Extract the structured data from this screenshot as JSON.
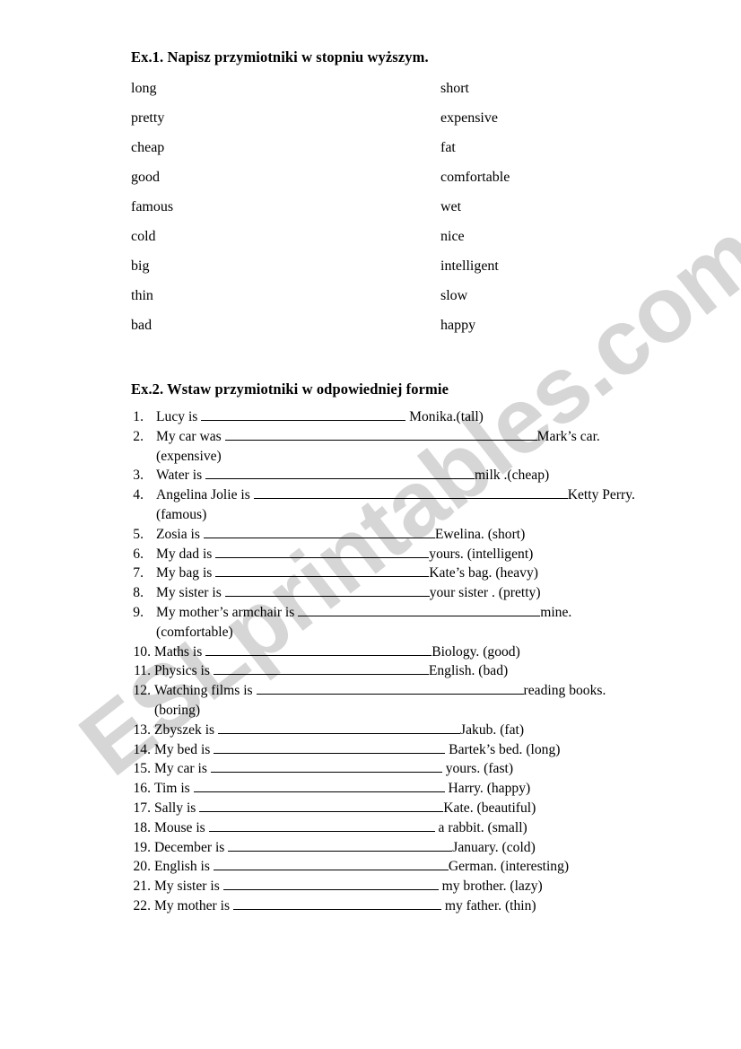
{
  "watermark": {
    "text": "ESLprintables.com",
    "color": "#d6d6d6"
  },
  "exercise1": {
    "heading": "Ex.1. Napisz przymiotniki w stopniu wyższym.",
    "pairs": [
      {
        "left": "long",
        "right": "short"
      },
      {
        "left": "pretty",
        "right": "expensive"
      },
      {
        "left": "cheap",
        "right": "fat"
      },
      {
        "left": "good",
        "right": "comfortable"
      },
      {
        "left": "famous",
        "right": "wet"
      },
      {
        "left": "cold",
        "right": "nice"
      },
      {
        "left": "big",
        "right": "intelligent"
      },
      {
        "left": "thin",
        "right": "slow"
      },
      {
        "left": "bad",
        "right": "happy"
      }
    ]
  },
  "exercise2": {
    "heading": "Ex.2. Wstaw przymiotniki w odpowiedniej formie",
    "items": [
      {
        "num": "1.",
        "pre": "Lucy is ",
        "blank": 228,
        "post": " Monika.(tall)",
        "cont": ""
      },
      {
        "num": "2.",
        "pre": "My car was ",
        "blank": 348,
        "post": "Mark’s car.",
        "cont": "(expensive)"
      },
      {
        "num": "3.",
        "pre": "Water is ",
        "blank": 300,
        "post": "milk .(cheap)",
        "cont": ""
      },
      {
        "num": "4.",
        "pre": "Angelina Jolie is ",
        "blank": 350,
        "post": "Ketty Perry.",
        "cont": "(famous)"
      },
      {
        "num": "5.",
        "pre": "Zosia is ",
        "blank": 258,
        "post": "Ewelina. (short)",
        "cont": ""
      },
      {
        "num": "6.",
        "pre": "My dad is ",
        "blank": 238,
        "post": "yours. (intelligent)",
        "cont": ""
      },
      {
        "num": "7.",
        "pre": "My bag is ",
        "blank": 238,
        "post": "Kate’s bag. (heavy)",
        "cont": ""
      },
      {
        "num": "8.",
        "pre": "My sister is ",
        "blank": 228,
        "post": "your sister . (pretty)",
        "cont": ""
      },
      {
        "num": "9.",
        "pre": "My mother’s armchair is ",
        "blank": 270,
        "post": "mine.",
        "cont": "(comfortable)"
      },
      {
        "num": "10.",
        "pre": "Maths is ",
        "blank": 252,
        "post": "Biology. (good)",
        "cont": ""
      },
      {
        "num": "11.",
        "pre": "Physics is ",
        "blank": 240,
        "post": "English. (bad)",
        "cont": ""
      },
      {
        "num": "12.",
        "pre": "Watching films is ",
        "blank": 298,
        "post": "reading books.",
        "cont": "(boring)"
      },
      {
        "num": "13.",
        "pre": "Zbyszek is ",
        "blank": 270,
        "post": "Jakub. (fat)",
        "cont": ""
      },
      {
        "num": "14.",
        "pre": "My bed is ",
        "blank": 258,
        "post": " Bartek’s bed. (long)",
        "cont": ""
      },
      {
        "num": "15.",
        "pre": "My car is ",
        "blank": 258,
        "post": " yours. (fast)",
        "cont": ""
      },
      {
        "num": "16.",
        "pre": "Tim is ",
        "blank": 280,
        "post": " Harry. (happy)",
        "cont": ""
      },
      {
        "num": "17.",
        "pre": "Sally is ",
        "blank": 272,
        "post": "Kate. (beautiful)",
        "cont": ""
      },
      {
        "num": "18.",
        "pre": "Mouse is ",
        "blank": 252,
        "post": " a rabbit. (small)",
        "cont": ""
      },
      {
        "num": "19.",
        "pre": "December is ",
        "blank": 250,
        "post": "January. (cold)",
        "cont": ""
      },
      {
        "num": "20.",
        "pre": "English is ",
        "blank": 262,
        "post": "German. (interesting)",
        "cont": ""
      },
      {
        "num": "21.",
        "pre": "My sister is ",
        "blank": 240,
        "post": " my brother. (lazy)",
        "cont": ""
      },
      {
        "num": "22.",
        "pre": "My mother is ",
        "blank": 232,
        "post": " my father. (thin)",
        "cont": ""
      }
    ]
  }
}
